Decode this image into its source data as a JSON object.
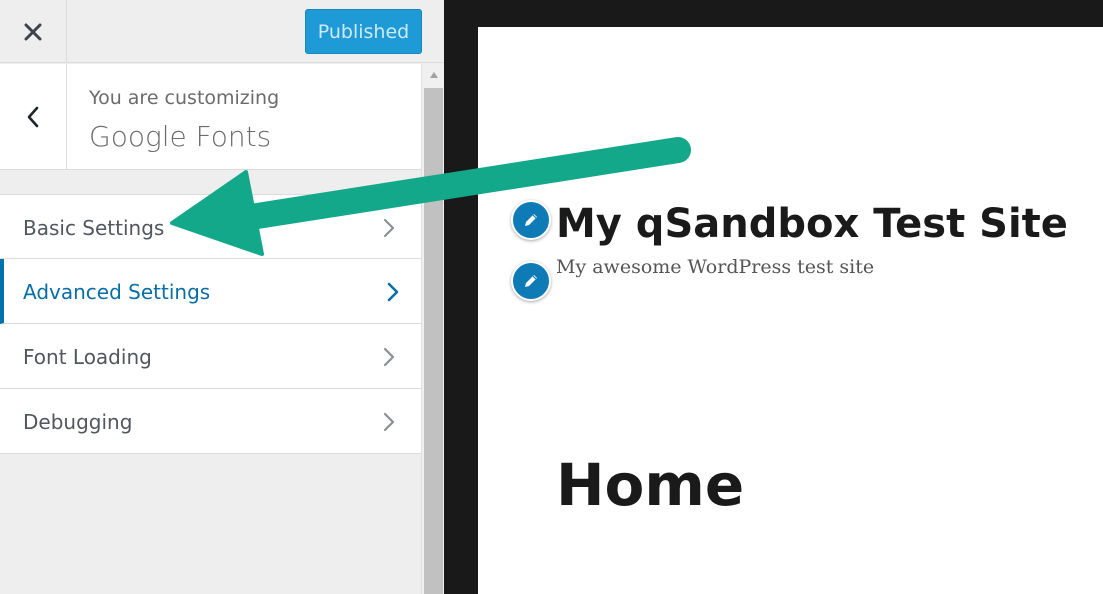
{
  "topbar": {
    "close_icon": "close-icon",
    "publish_label": "Published"
  },
  "panel_header": {
    "back_icon": "chevron-left-icon",
    "customizing_label": "You are customizing",
    "title": "Google Fonts"
  },
  "sections": [
    {
      "label": "Basic Settings",
      "active": false
    },
    {
      "label": "Advanced Settings",
      "active": true
    },
    {
      "label": "Font Loading",
      "active": false
    },
    {
      "label": "Debugging",
      "active": false
    }
  ],
  "preview": {
    "site_title": "My qSandbox Test Site",
    "site_tagline": "My awesome WordPress test site",
    "page_heading": "Home",
    "edit_icon": "pencil-icon"
  },
  "annotation": {
    "arrow_color": "#14a88a",
    "points_to": "Basic Settings"
  },
  "colors": {
    "accent": "#0073aa",
    "publish_button": "#1e9bd7",
    "preview_frame": "#191919"
  }
}
